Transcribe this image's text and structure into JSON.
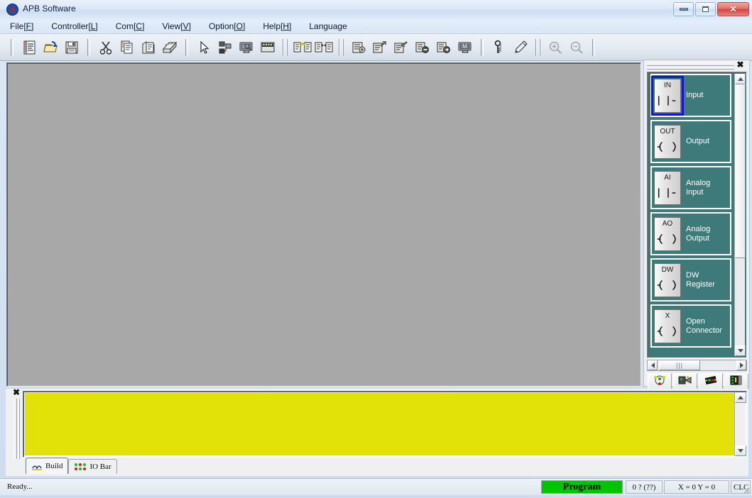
{
  "window": {
    "title": "APB Software",
    "app_icon": "apb-logo-icon",
    "controls": {
      "minimize": "minimize-button",
      "maximize": "maximize-button",
      "close": "close-button",
      "close_glyph": "✕"
    }
  },
  "menu": {
    "items": [
      {
        "text": "File[F]",
        "pre": "File[",
        "key": "F",
        "post": "]"
      },
      {
        "text": "Controller[L]",
        "pre": "Controller[",
        "key": "L",
        "post": "]"
      },
      {
        "text": "Com[C]",
        "pre": "Com[",
        "key": "C",
        "post": "]"
      },
      {
        "text": "View[V]",
        "pre": "View[",
        "key": "V",
        "post": "]"
      },
      {
        "text": "Option[O]",
        "pre": "Option[",
        "key": "O",
        "post": "]"
      },
      {
        "text": "Help[H]",
        "pre": "Help[",
        "key": "H",
        "post": "]"
      },
      {
        "text": "Language",
        "pre": "Language",
        "key": "",
        "post": ""
      }
    ]
  },
  "toolbar": {
    "groups": [
      {
        "tools": [
          {
            "name": "new-document-icon",
            "title": "New"
          },
          {
            "name": "open-folder-icon",
            "title": "Open"
          },
          {
            "name": "save-disk-icon",
            "title": "Save"
          }
        ]
      },
      {
        "tools": [
          {
            "name": "cut-scissors-icon",
            "title": "Cut"
          },
          {
            "name": "copy-icon",
            "title": "Copy"
          },
          {
            "name": "paste-icon",
            "title": "Paste"
          },
          {
            "name": "print-icon",
            "title": "Print"
          }
        ]
      },
      {
        "tools": [
          {
            "name": "select-arrow-icon",
            "title": "Select"
          },
          {
            "name": "block-hierarchy-icon",
            "title": "Blocks"
          },
          {
            "name": "monitor-icon",
            "title": "Monitor"
          },
          {
            "name": "io-panel-icon",
            "title": "IO Panel"
          }
        ]
      },
      {
        "tools": [
          {
            "name": "connect-icon",
            "title": "Connect"
          },
          {
            "name": "disconnect-icon",
            "title": "Disconnect"
          }
        ]
      },
      {
        "tools": [
          {
            "name": "controller-config-icon",
            "title": "Controller"
          },
          {
            "name": "upload-program-icon",
            "title": "Upload"
          },
          {
            "name": "download-program-icon",
            "title": "Download"
          },
          {
            "name": "program-stop-icon",
            "title": "Stop"
          },
          {
            "name": "program-run-icon",
            "title": "Run"
          },
          {
            "name": "monitor-run-icon",
            "title": "Monitor Run"
          }
        ]
      },
      {
        "tools": [
          {
            "name": "keys-password-icon",
            "title": "Password"
          },
          {
            "name": "pen-edit-icon",
            "title": "Edit"
          }
        ]
      },
      {
        "tools": [
          {
            "name": "zoom-in-icon",
            "title": "Zoom In",
            "disabled": true
          },
          {
            "name": "zoom-out-icon",
            "title": "Zoom Out",
            "disabled": true
          }
        ]
      }
    ]
  },
  "palette": {
    "close_glyph": "✖",
    "selected_index": 0,
    "items": [
      {
        "tag": "IN",
        "label": "Input",
        "symbol": "contact",
        "selected": true
      },
      {
        "tag": "OUT",
        "label": "Output",
        "symbol": "coil",
        "selected": false
      },
      {
        "tag": "AI",
        "label": "Analog\nInput",
        "symbol": "contact",
        "selected": false
      },
      {
        "tag": "AO",
        "label": "Analog\nOutput",
        "symbol": "coil",
        "selected": false
      },
      {
        "tag": "DW",
        "label": "DW\nRegister",
        "symbol": "coil",
        "selected": false
      },
      {
        "tag": "X",
        "label": "Open\nConnector",
        "symbol": "coil",
        "selected": false
      }
    ],
    "bottom_buttons": [
      {
        "name": "palette-tab-basic-button",
        "icon": "node-cluster-icon"
      },
      {
        "name": "palette-tab-logic-button",
        "icon": "logic-block-icon"
      },
      {
        "name": "palette-tab-function-button",
        "icon": "chip-icon"
      },
      {
        "name": "palette-tab-advanced-button",
        "icon": "board-icon"
      }
    ]
  },
  "output": {
    "close_glyph": "✖",
    "content": "",
    "background_color": "#e2e208",
    "tabs": [
      {
        "label": "Build",
        "icon": "build-hammer-icon",
        "active": true
      },
      {
        "label": "IO Bar",
        "icon": "io-dots-icon",
        "active": false
      }
    ]
  },
  "status": {
    "message": "Ready...",
    "mode": "Program",
    "mode_color": "#00c400",
    "counts": "0 ? (??)",
    "coordinates": "X = 0  Y = 0",
    "controller": "CLC"
  }
}
